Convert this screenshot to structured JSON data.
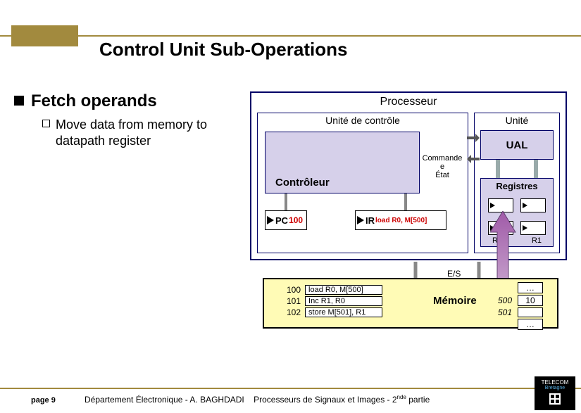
{
  "title": "Control Unit Sub-Operations",
  "bullet": {
    "main": "Fetch operands",
    "sub": "Move data from memory to datapath register"
  },
  "proc": {
    "title": "Processeur",
    "uc": "Unité de contrôle",
    "ue": "Unité",
    "ctrl": "Contrôleur",
    "cmd": "Commande",
    "etat": "État",
    "ual": "UAL",
    "registres": "Registres",
    "pc_label": "PC",
    "pc_val": "100",
    "ir_label": "IR",
    "ir_val": "load R0, M[500]",
    "r0": "R0",
    "r1": "R1"
  },
  "es": "E/S",
  "mem": {
    "label": "Mémoire",
    "code": [
      {
        "addr": "100",
        "instr": "load  R0, M[500]"
      },
      {
        "addr": "101",
        "instr": "Inc    R1, R0"
      },
      {
        "addr": "102",
        "instr": "store M[501], R1"
      }
    ],
    "data": [
      {
        "addr": "",
        "val": "…"
      },
      {
        "addr": "500",
        "val": "10"
      },
      {
        "addr": "501",
        "val": ""
      },
      {
        "addr": "",
        "val": "…"
      }
    ]
  },
  "footer": {
    "page": "page 9",
    "text_a": "Département Électronique - A. BAGHDADI",
    "text_b": "Processeurs de Signaux et Images - 2",
    "text_c": " partie",
    "nde": "nde",
    "logo1": "TELECOM",
    "logo2": "Bretagne"
  }
}
